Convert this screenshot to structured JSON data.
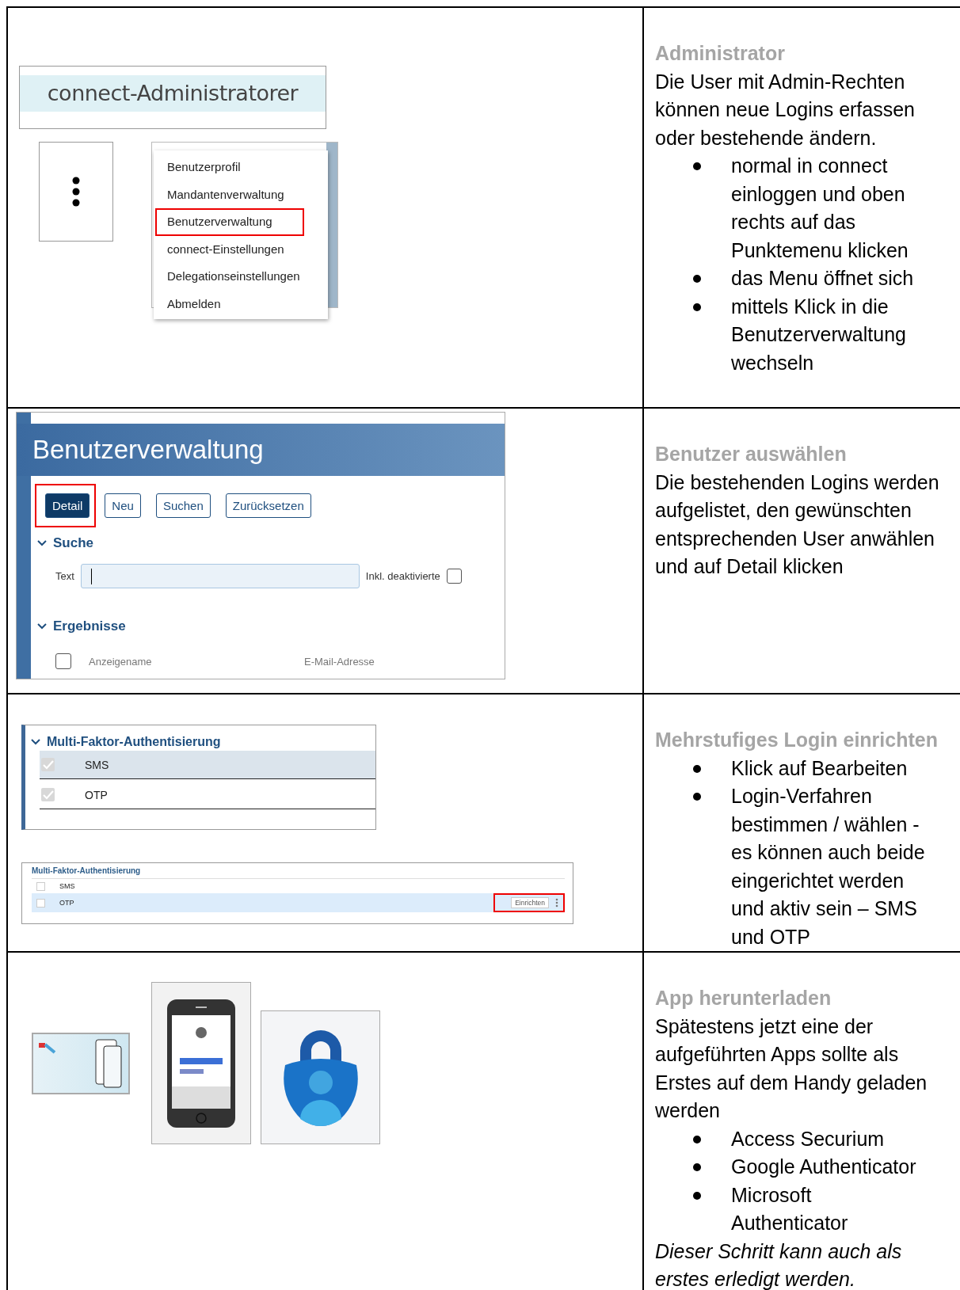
{
  "rows": [
    {
      "kind": "menu",
      "header": "connect-Administratorer",
      "menu": [
        {
          "label": "Benutzerprofil",
          "marked": false
        },
        {
          "label": "Mandantenverwaltung",
          "marked": false
        },
        {
          "label": "Benutzerverwaltung",
          "marked": true
        },
        {
          "label": "connect-Einstellungen",
          "marked": false
        },
        {
          "label": "Delegationseinstellungen",
          "marked": false
        },
        {
          "label": "Abmelden",
          "marked": false
        }
      ],
      "heading": "Administrator",
      "blocks": [
        {
          "kind": "text",
          "text": "Die User mit Admin-Rechten können neue Logins erfassen oder bestehende ändern."
        },
        {
          "kind": "bullets",
          "items": [
            "normal in connect einloggen und oben rechts auf das Punktemenu klicken",
            "das Menu öffnet sich",
            "mittels Klick in die Benutzerverwaltung wechseln"
          ]
        }
      ]
    },
    {
      "kind": "users",
      "title": "Benutzerverwaltung",
      "buttons": [
        {
          "label": "Detail",
          "primary": true,
          "marked": true
        },
        {
          "label": "Neu",
          "primary": false,
          "marked": false
        },
        {
          "label": "Suchen",
          "primary": false,
          "marked": false
        },
        {
          "label": "Zurücksetzen",
          "primary": false,
          "marked": false
        }
      ],
      "search": {
        "title": "Suche",
        "expanded": true,
        "label": "Text",
        "toggle_label": "Inkl. deaktivierte",
        "toggle_checked": false
      },
      "results": {
        "title": "Ergebnisse",
        "expanded": true,
        "checked": false,
        "columns": [
          "Anzeigename",
          "E-Mail-Adresse"
        ]
      },
      "heading": "Benutzer auswählen",
      "blocks": [
        {
          "kind": "text",
          "text": "Die bestehenden Logins werden aufgelistet, den gewünschten entsprechenden User anwählen und auf Detail klicken"
        }
      ]
    },
    {
      "kind": "mfa",
      "panels": [
        {
          "kind": "large",
          "title": "Multi-Faktor-Authentisierung",
          "expanded": true,
          "options": [
            {
              "label": "SMS",
              "checked": true,
              "selected": true
            },
            {
              "label": "OTP",
              "checked": true,
              "selected": false
            }
          ]
        },
        {
          "kind": "compact",
          "title": "Multi-Faktor-Authentisierung",
          "options": [
            {
              "label": "SMS",
              "checked": false,
              "selected": false
            },
            {
              "label": "OTP",
              "checked": false,
              "selected": true,
              "action": "Einrichten",
              "marked": true
            }
          ]
        }
      ],
      "heading": "Mehrstufiges Login einrichten",
      "blocks": [
        {
          "kind": "bullets",
          "items": [
            "Klick auf Bearbeiten",
            "Login-Verfahren bestimmen / wählen - es können auch beide eingerichtet werden und aktiv sein – SMS und OTP"
          ]
        }
      ]
    },
    {
      "kind": "apps",
      "apps": [
        {
          "kind": "banner"
        },
        {
          "kind": "phone"
        },
        {
          "kind": "lock"
        }
      ],
      "heading": "App herunterladen",
      "blocks": [
        {
          "kind": "text",
          "text": "Spätestens jetzt eine der aufgeführten Apps sollte als Erstes auf dem Handy geladen werden"
        },
        {
          "kind": "bullets",
          "items": [
            "Access Securium",
            "Google Authenticator",
            "Microsoft Authenticator"
          ]
        },
        {
          "kind": "note",
          "text": "Dieser Schritt kann auch als erstes erledigt werden."
        }
      ]
    }
  ]
}
